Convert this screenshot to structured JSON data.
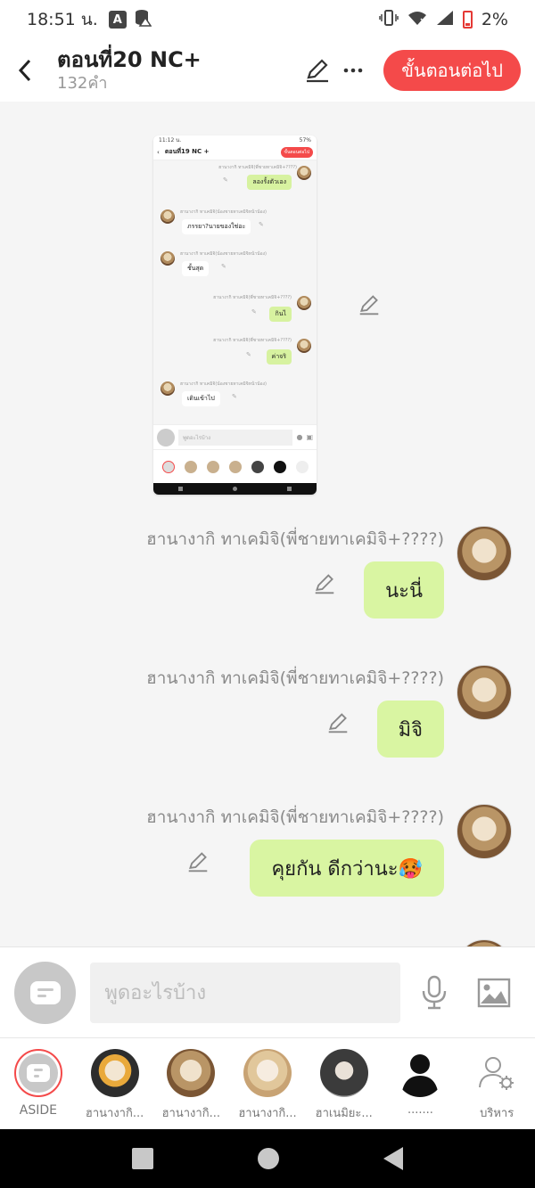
{
  "status_bar": {
    "time": "18:51 น.",
    "badge": "A",
    "battery": "2%"
  },
  "header": {
    "title": "ตอนที่20 NC+",
    "word_count": "132คำ",
    "next_button": "ขั้นตอนต่อไป"
  },
  "preview": {
    "status_time": "11:12 น.",
    "status_battery": "57%",
    "title": "ตอนที่19 NC +",
    "next_button": "ขั้นตอนต่อไป",
    "input_placeholder": "พูดอะไรบ้าง",
    "messages": [
      {
        "sender": "ฮานางากิ ทาเคมิจิ(พี่ชายทาเคมิจิ+????)",
        "text": "ลองรั้งตัวเอง"
      },
      {
        "sender": "ฮานางากิ ทาเคมิจิ(น้องชายทาเคมิจิหน้าน้อง)",
        "text": "ภรรยา?นายของใช่อะ"
      },
      {
        "sender": "ฮานางากิ ทาเคมิจิ(น้องชายทาเคมิจิหน้าน้อง)",
        "text": "ชั้นสุด"
      },
      {
        "sender": "ฮานางากิ ทาเคมิจิ(พี่ชายทาเคมิจิ+????)",
        "text": "กินไ"
      },
      {
        "sender": "ฮานางากิ ทาเคมิจิ(พี่ชายทาเคมิจิ+????)",
        "text": "ค่าจริ"
      },
      {
        "sender": "ฮานางากิ ทาเคมิจิ(น้องชายทาเคมิจิหน้าน้อง)",
        "text": "เดินเข้าไป"
      }
    ]
  },
  "messages": [
    {
      "sender": "ฮานางากิ ทาเคมิจิ(พี่ชายทาเคมิจิ+????)",
      "text": "นะนี่"
    },
    {
      "sender": "ฮานางากิ ทาเคมิจิ(พี่ชายทาเคมิจิ+????)",
      "text": "มิจิ"
    },
    {
      "sender": "ฮานางากิ ทาเคมิจิ(พี่ชายทาเคมิจิ+????)",
      "text": "คุยกัน ดีกว่านะ🥵"
    }
  ],
  "input": {
    "placeholder": "พูดอะไรบ้าง"
  },
  "characters": [
    {
      "label": "ASIDE"
    },
    {
      "label": "ฮานางากิ..."
    },
    {
      "label": "ฮานางากิ..."
    },
    {
      "label": "ฮานางากิ..."
    },
    {
      "label": "ฮาเนมิยะ..."
    },
    {
      "label": "......."
    },
    {
      "label": "บริหาร"
    }
  ],
  "colors": {
    "accent": "#f44a4a",
    "bubble": "#d9f5a2"
  }
}
